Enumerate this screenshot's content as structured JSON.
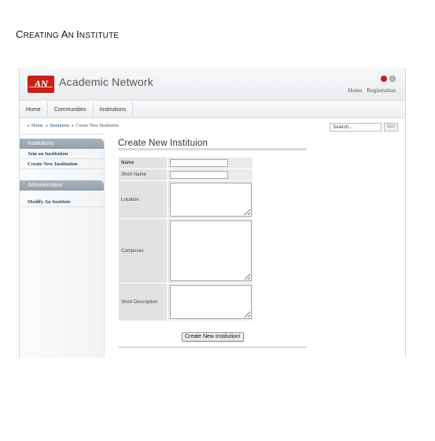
{
  "document": {
    "heading_parts": [
      {
        "text": "C",
        "size": "big"
      },
      {
        "text": "REATING ",
        "size": "sm"
      },
      {
        "text": "A",
        "size": "big"
      },
      {
        "text": "N ",
        "size": "sm"
      },
      {
        "text": "I",
        "size": "big"
      },
      {
        "text": "NSTITUTE",
        "size": "sm"
      }
    ]
  },
  "header": {
    "logo_text": "AN",
    "brand": "Academic Network",
    "top_links": [
      "Home",
      "Registration"
    ]
  },
  "nav": {
    "tabs": [
      "Home",
      "Communities",
      "Institutions"
    ]
  },
  "breadcrumb": {
    "home": "Home",
    "section": "Institution",
    "current": "Create New Institution"
  },
  "search": {
    "value": "Search...",
    "button": "GO!"
  },
  "sidebar": {
    "sections": [
      {
        "title": "Institutions",
        "items": [
          "Join an Institution",
          "Create New Institution"
        ]
      },
      {
        "title": "Administration",
        "items": [
          "Modify An Institute"
        ]
      }
    ]
  },
  "main": {
    "title": "Create New Instituion",
    "fields": [
      {
        "label": "Name",
        "type": "input",
        "bold": true
      },
      {
        "label": "Short Name",
        "type": "input",
        "bold": false
      },
      {
        "label": "Location",
        "type": "textarea",
        "rows": 5,
        "bold": false
      },
      {
        "label": "Campuses",
        "type": "textarea",
        "rows": 9,
        "bold": false
      },
      {
        "label": "Short Description",
        "type": "textarea",
        "rows": 5,
        "bold": false
      }
    ],
    "submit_label": "Create New Institution!"
  }
}
